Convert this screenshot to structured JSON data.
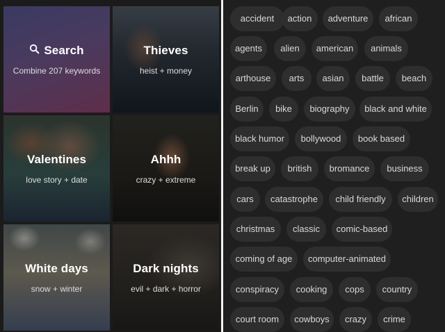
{
  "tiles": [
    {
      "id": "search",
      "title": "Search",
      "subtitle": "Combine 207 keywords",
      "icon": "search-icon"
    },
    {
      "id": "thieves",
      "title": "Thieves",
      "subtitle": "heist + money"
    },
    {
      "id": "valentines",
      "title": "Valentines",
      "subtitle": "love story + date"
    },
    {
      "id": "ahhh",
      "title": "Ahhh",
      "subtitle": "crazy + extreme"
    },
    {
      "id": "white",
      "title": "White days",
      "subtitle": "snow + winter"
    },
    {
      "id": "dark",
      "title": "Dark nights",
      "subtitle": "evil + dark + horror"
    }
  ],
  "keywords": [
    "accident",
    "action",
    "adventure",
    "african",
    "agents",
    "alien",
    "american",
    "animals",
    "arthouse",
    "arts",
    "asian",
    "battle",
    "beach",
    "Berlin",
    "bike",
    "biography",
    "black and white",
    "black humor",
    "bollywood",
    "book based",
    "break up",
    "british",
    "bromance",
    "business",
    "cars",
    "catastrophe",
    "child friendly",
    "children",
    "christmas",
    "classic",
    "comic-based",
    "coming of age",
    "computer-animated",
    "conspiracy",
    "cooking",
    "cops",
    "country",
    "court room",
    "cowboys",
    "crazy",
    "crime"
  ],
  "colors": {
    "background": "#111111",
    "panel": "#1f1f1f",
    "chip": "#2e2e2e",
    "chip_text": "#d9d9d9",
    "divider": "#f2f2f2"
  }
}
